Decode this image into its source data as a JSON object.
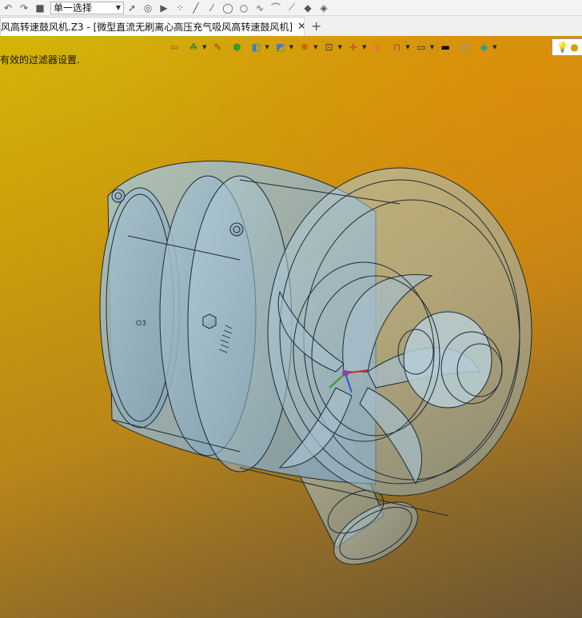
{
  "top_toolbar": {
    "icons": [
      "undo-icon",
      "redo-icon",
      "stop-icon"
    ],
    "selection_mode": "单一选择",
    "tool_icons": [
      "pointer-icon",
      "filter-icon",
      "play-icon",
      "point-icon",
      "line-icon",
      "arc-icon",
      "circle-icon",
      "curve-icon",
      "spline-icon",
      "sketch-icon",
      "shape-icon",
      "box-icon"
    ]
  },
  "tabs": {
    "document_title": "风高转速鼓风机.Z3 - [微型直流无刷离心高压充气吸风高转速鼓风机]",
    "close_glyph": "✕",
    "add_glyph": "+"
  },
  "viewport": {
    "status_message": "有效的过滤器设置.",
    "background_colors": [
      "#d5b408",
      "#c99a0c",
      "#b98618",
      "#8f6b28",
      "#6a5432"
    ]
  }
}
